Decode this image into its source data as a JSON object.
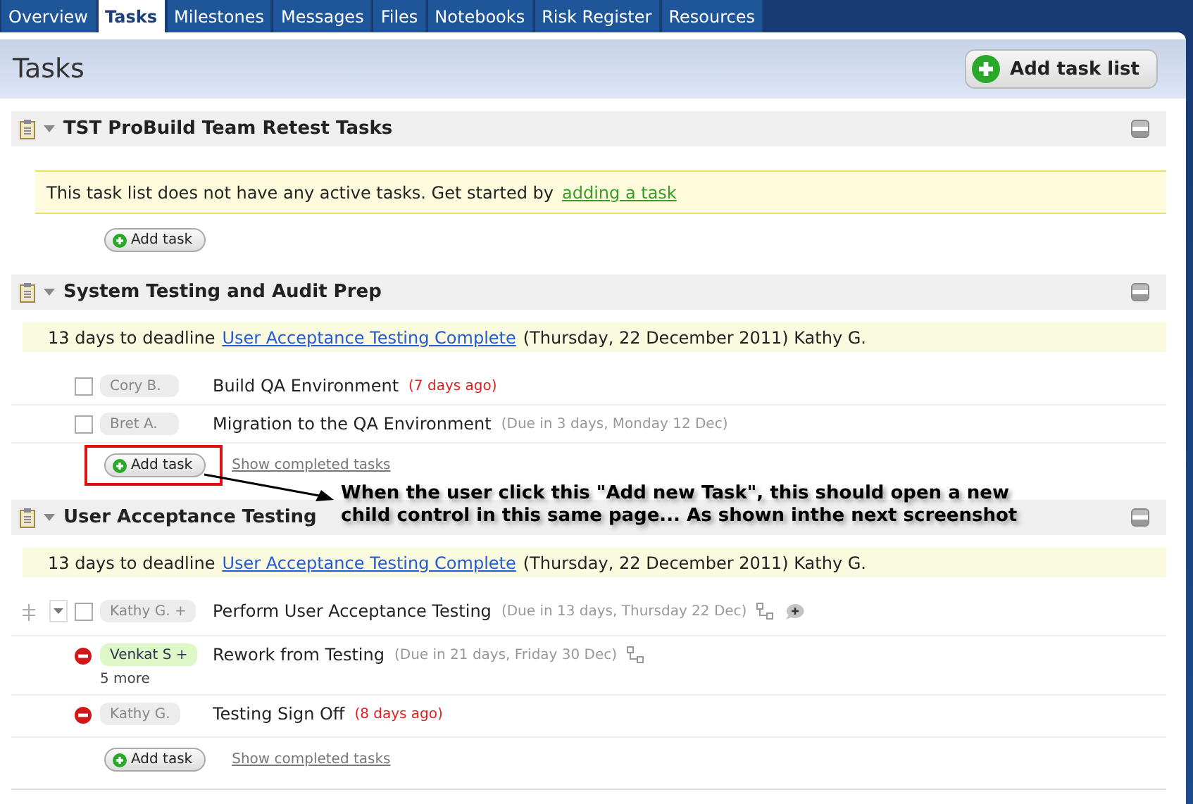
{
  "tabs": [
    {
      "label": "Overview",
      "selected": false
    },
    {
      "label": "Tasks",
      "selected": true
    },
    {
      "label": "Milestones",
      "selected": false
    },
    {
      "label": "Messages",
      "selected": false
    },
    {
      "label": "Files",
      "selected": false
    },
    {
      "label": "Notebooks",
      "selected": false
    },
    {
      "label": "Risk Register",
      "selected": false
    },
    {
      "label": "Resources",
      "selected": false
    }
  ],
  "page": {
    "title": "Tasks",
    "add_list_button": "Add task list"
  },
  "task_lists": [
    {
      "title": "TST ProBuild Team Retest Tasks",
      "notice": {
        "text": "This task list does not have any active tasks. Get started by",
        "link": "adding a task"
      },
      "add_button": "Add task",
      "highlighted": false
    },
    {
      "title": "System Testing and Audit Prep",
      "deadline": {
        "days": "13 days to deadline",
        "link": "User Acceptance Testing Complete",
        "details": "(Thursday, 22 December 2011) Kathy G."
      },
      "tasks": [
        {
          "kind": "checkbox",
          "checked": false,
          "assignee": "Cory B.",
          "assignee_highlighted": false,
          "title": "Build QA Environment",
          "due": "(7 days ago)",
          "overdue": true
        },
        {
          "kind": "checkbox",
          "checked": false,
          "assignee": "Bret A.",
          "assignee_highlighted": false,
          "title": "Migration to the QA Environment",
          "due": "(Due in 3 days, Monday 12 Dec)",
          "overdue": false
        }
      ],
      "add_button": "Add task",
      "show_completed": "Show completed tasks",
      "highlighted": true
    },
    {
      "title": "User Acceptance Testing",
      "deadline": {
        "days": "13 days to deadline",
        "link": "User Acceptance Testing Complete",
        "details": "(Thursday, 22 December 2011) Kathy G."
      },
      "tasks": [
        {
          "kind": "parent",
          "checked": false,
          "assignee": "Kathy G. +",
          "assignee_highlighted": false,
          "title": "Perform User Acceptance Testing",
          "due": "(Due in 13 days, Thursday 22 Dec)",
          "overdue": false,
          "subtasks_icon": true,
          "comment_icon": true
        },
        {
          "kind": "blocked",
          "assignee": "Venkat S +",
          "assignee_highlighted": true,
          "title": "Rework from Testing",
          "due": "(Due in 21 days, Friday 30 Dec)",
          "overdue": false,
          "subtasks_icon": true,
          "more": "5 more"
        },
        {
          "kind": "blocked",
          "assignee": "Kathy G.",
          "assignee_highlighted": false,
          "title": "Testing Sign Off",
          "due": "(8 days ago)",
          "overdue": true
        }
      ],
      "add_button": "Add task",
      "show_completed": "Show completed tasks",
      "highlighted": false
    }
  ],
  "annotation": {
    "lines": [
      "When the user click this \"Add new Task\", this should open a new",
      "child control in this same page... As shown inthe next screenshot"
    ]
  }
}
